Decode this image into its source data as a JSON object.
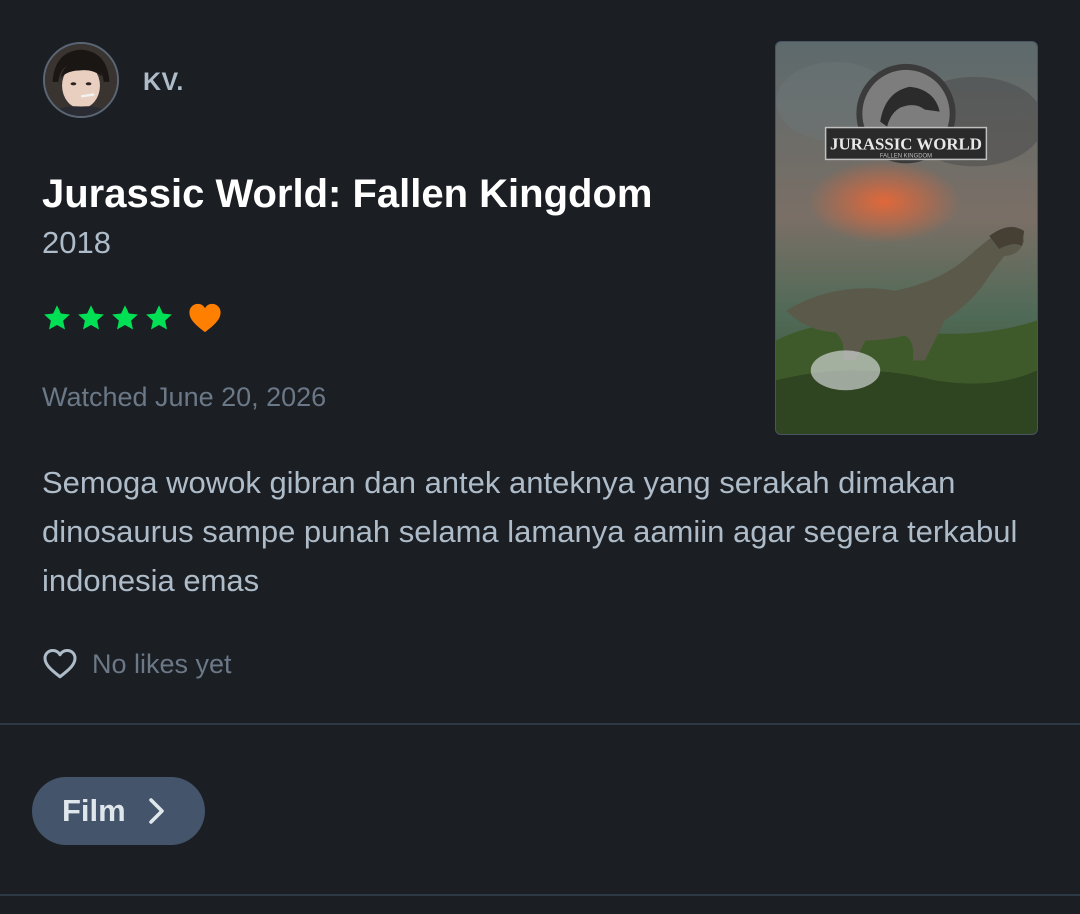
{
  "user": {
    "name": "KV."
  },
  "film": {
    "title": "Jurassic World: Fallen Kingdom",
    "year": "2018",
    "poster_logo_line1": "JURASSIC WORLD",
    "poster_logo_line2": "FALLEN KINGDOM"
  },
  "rating": {
    "stars": 4,
    "max_stars": 5,
    "liked": true,
    "star_color": "#00e054",
    "heart_color": "#ff8000"
  },
  "watched": "Watched June 20, 2026",
  "review": {
    "text": "Semoga wowok gibran dan antek anteknya yang serakah dimakan dinosaurus sampe punah selama lamanya aamiin agar segera terkabul indonesia emas"
  },
  "likes": {
    "text": "No likes yet",
    "icon": "heart-outline-icon"
  },
  "nav": {
    "film_button_label": "Film",
    "film_button_icon": "chevron-right-icon"
  },
  "colors": {
    "background": "#1b1e23",
    "text_primary": "#ffffff",
    "text_secondary": "#aebcc9",
    "text_muted": "#6b7887",
    "pill": "#44546a"
  }
}
